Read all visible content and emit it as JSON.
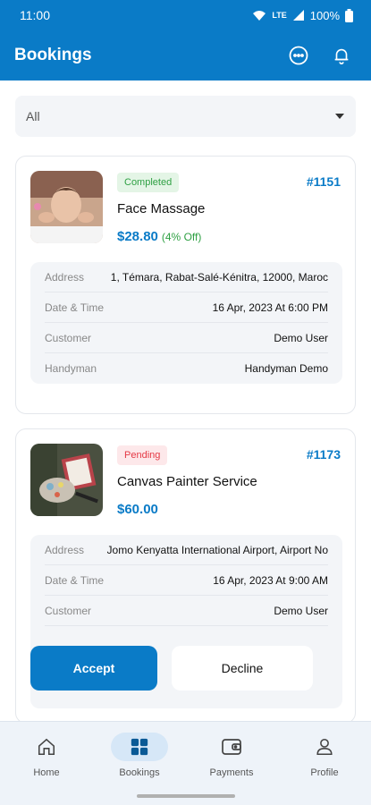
{
  "status_bar": {
    "time": "11:00",
    "network": "LTE",
    "battery": "100%"
  },
  "app_bar": {
    "title": "Bookings",
    "chat_icon": "chat-bubble-icon",
    "bell_icon": "bell-icon"
  },
  "filter": {
    "value": "All"
  },
  "bookings": [
    {
      "status": "Completed",
      "number": "#1151",
      "service": "Face Massage",
      "price": "$28.80",
      "discount": "(4% Off)",
      "details": [
        {
          "label": "Address",
          "value": "1, Témara, Rabat-Salé-Kénitra, 12000, Maroc"
        },
        {
          "label": "Date & Time",
          "value": "16 Apr, 2023 At 6:00 PM"
        },
        {
          "label": "Customer",
          "value": "Demo User"
        },
        {
          "label": "Handyman",
          "value": "Handyman Demo"
        }
      ]
    },
    {
      "status": "Pending",
      "number": "#1173",
      "service": "Canvas Painter Service",
      "price": "$60.00",
      "details": [
        {
          "label": "Address",
          "value": "Jomo Kenyatta International Airport, Airport No"
        },
        {
          "label": "Date & Time",
          "value": "16 Apr, 2023 At 9:00 AM"
        },
        {
          "label": "Customer",
          "value": "Demo User"
        }
      ],
      "actions": {
        "accept": "Accept",
        "decline": "Decline"
      }
    }
  ],
  "nav": [
    {
      "label": "Home",
      "icon": "home-icon",
      "active": false
    },
    {
      "label": "Bookings",
      "icon": "bookings-icon",
      "active": true
    },
    {
      "label": "Payments",
      "icon": "wallet-icon",
      "active": false
    },
    {
      "label": "Profile",
      "icon": "profile-icon",
      "active": false
    }
  ],
  "colors": {
    "primary": "#0a7bc7",
    "completed": "#2ea043",
    "pending": "#e53945"
  }
}
